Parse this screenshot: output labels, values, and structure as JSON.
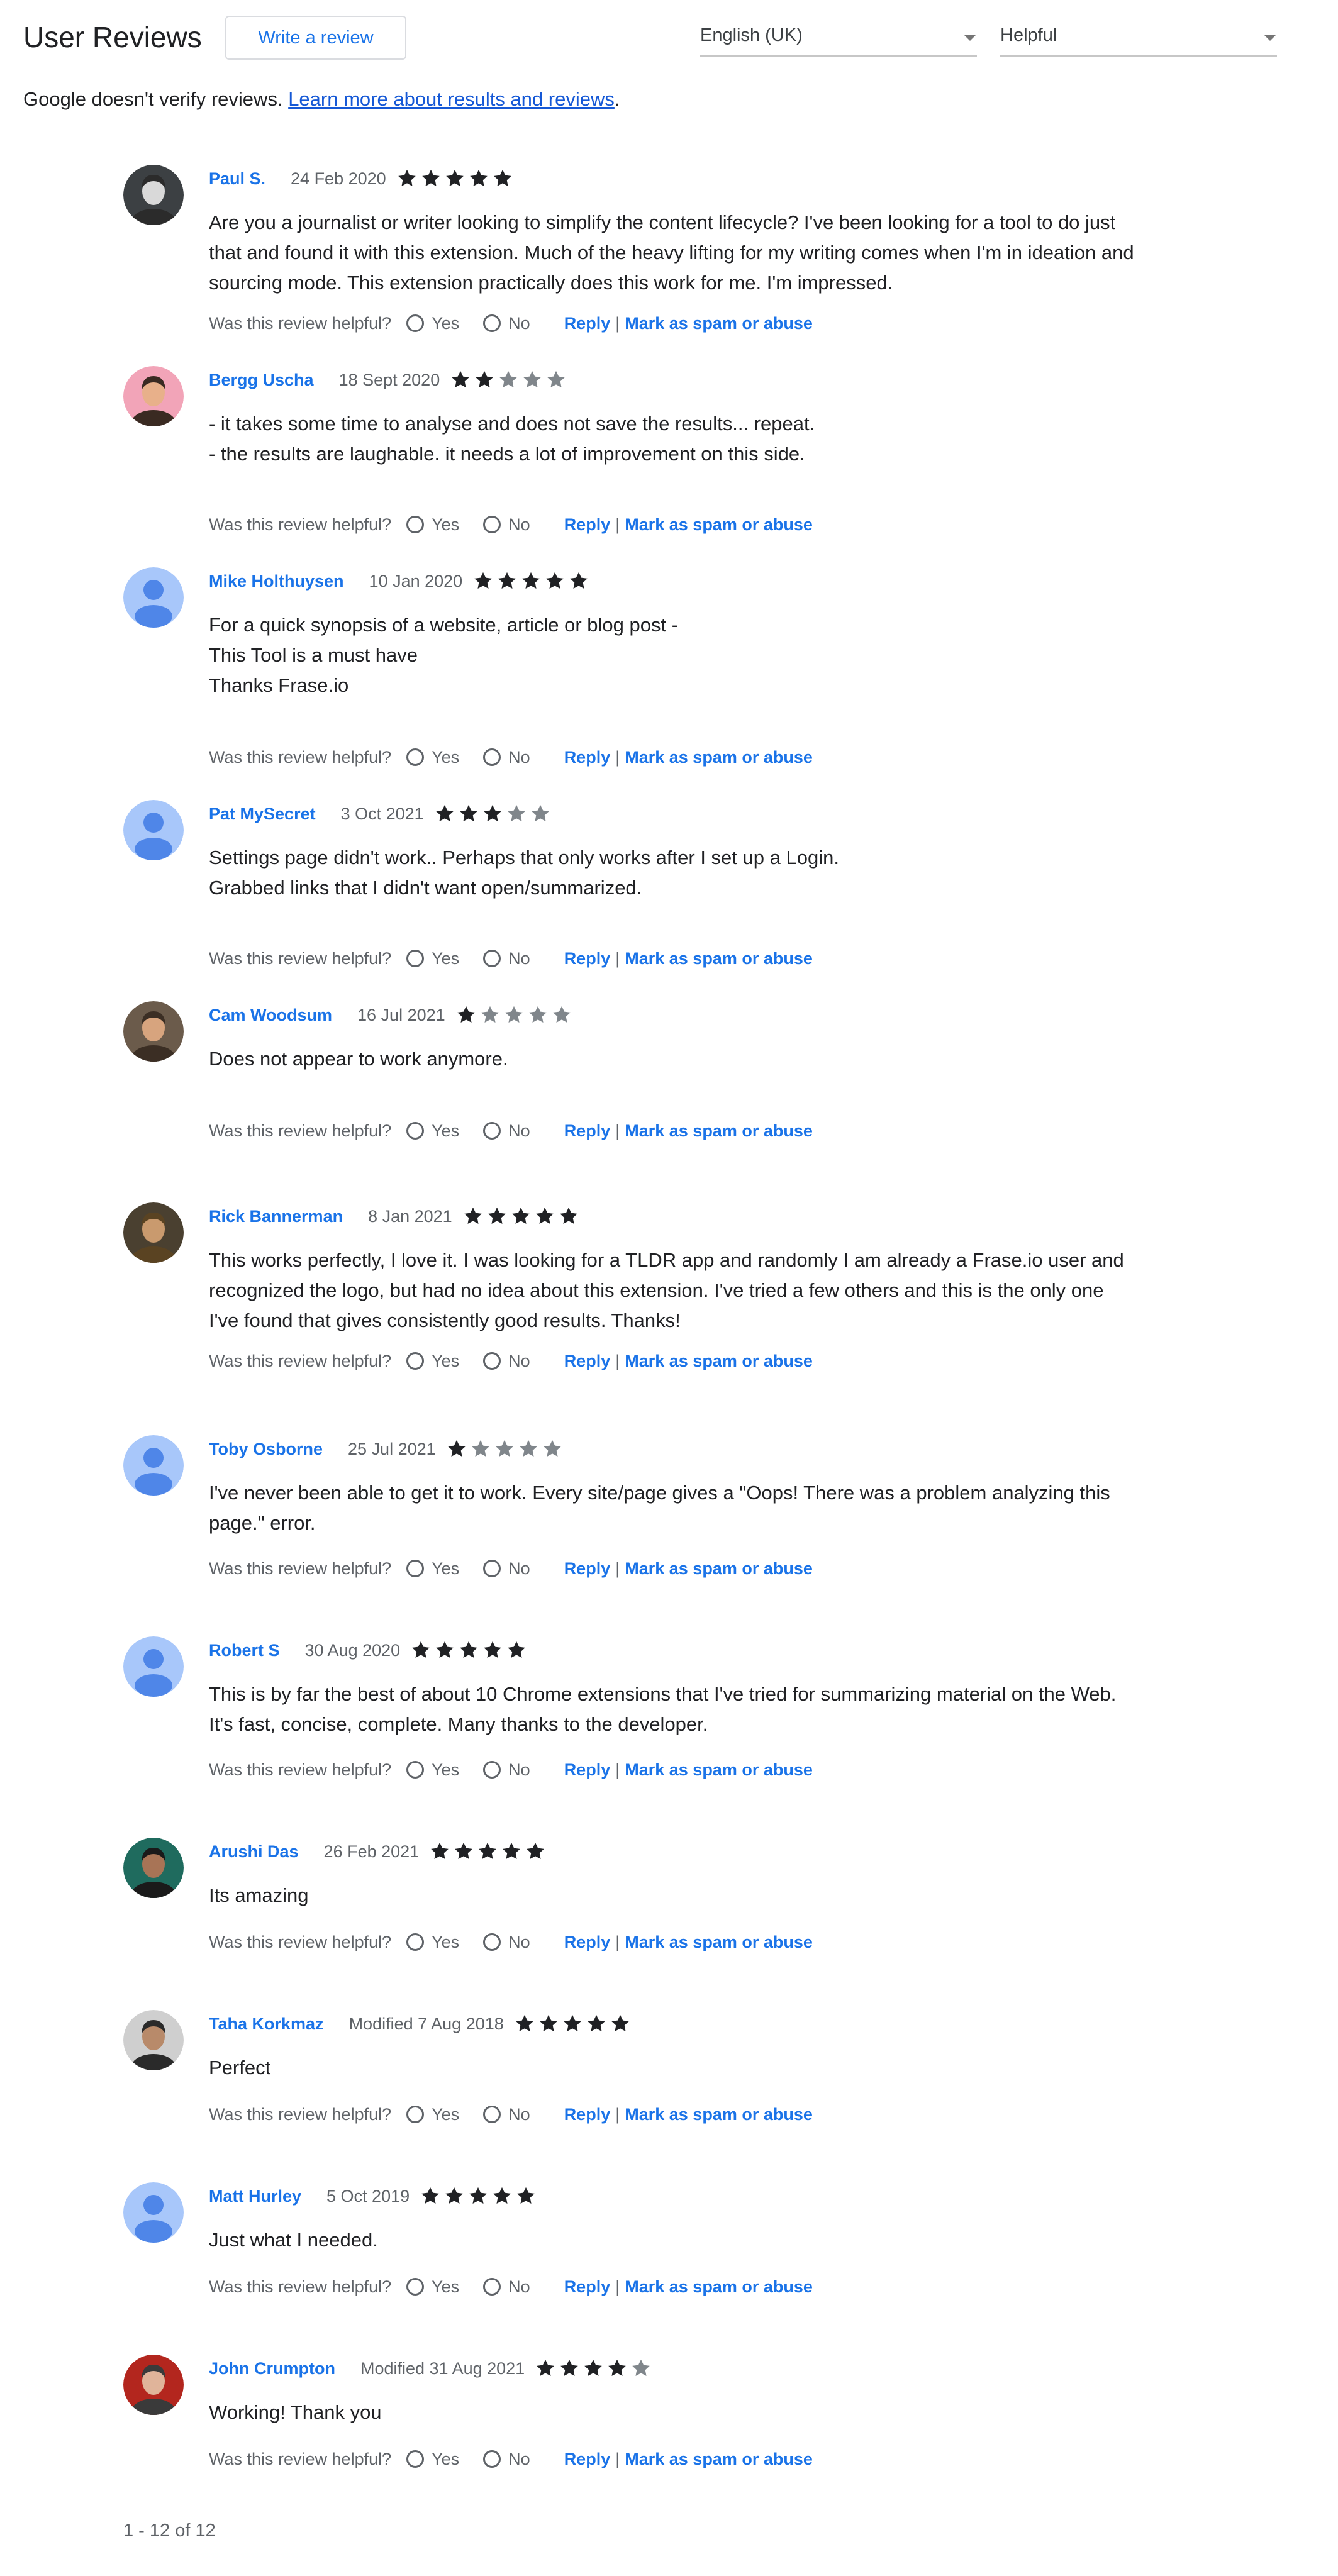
{
  "header": {
    "title": "User Reviews",
    "write_review_label": "Write a review",
    "language_select": "English (UK)",
    "sort_select": "Helpful"
  },
  "notice": {
    "text": "Google doesn't verify reviews.",
    "link_text": "Learn more about results and reviews",
    "suffix": "."
  },
  "helpful_labels": {
    "question": "Was this review helpful?",
    "yes": "Yes",
    "no": "No",
    "reply": "Reply",
    "separator": "|",
    "spam": "Mark as spam or abuse"
  },
  "colors": {
    "link": "#1a73e8",
    "star_filled": "#202124",
    "star_empty": "#80868b",
    "avatar_placeholder_bg": "#a8c7fa",
    "avatar_placeholder_fg": "#4f86e8"
  },
  "reviews": [
    {
      "author": "Paul S.",
      "date": "24 Feb 2020",
      "rating": 5,
      "avatar": "photo",
      "text": "Are you a journalist or writer looking to simplify the content lifecycle? I've been looking for a tool to do just\nthat and found it with this extension. Much of the heavy lifting for my writing comes when I'm in ideation and\nsourcing mode. This extension practically does this work for me. I'm impressed."
    },
    {
      "author": "Bergg Uscha",
      "date": "18 Sept 2020",
      "rating": 2,
      "avatar": "photo",
      "text": "- it takes some time to analyse and does not save the results... repeat.\n- the results are laughable. it needs a lot of improvement on this side."
    },
    {
      "author": "Mike Holthuysen",
      "date": "10 Jan 2020",
      "rating": 5,
      "avatar": "placeholder",
      "text": "For a quick synopsis of a website, article or blog post -\nThis Tool is a must have\nThanks Frase.io"
    },
    {
      "author": "Pat MySecret",
      "date": "3 Oct 2021",
      "rating": 3,
      "avatar": "placeholder",
      "text": "Settings page didn't work.. Perhaps that only works after I set up a Login.\nGrabbed links that I didn't want open/summarized."
    },
    {
      "author": "Cam Woodsum",
      "date": "16 Jul 2021",
      "rating": 1,
      "avatar": "photo",
      "text": "Does not appear to work anymore."
    },
    {
      "author": "Rick Bannerman",
      "date": "8 Jan 2021",
      "rating": 5,
      "avatar": "photo",
      "text": "This works perfectly, I love it. I was looking for a TLDR app and randomly I am already a Frase.io user and\nrecognized the logo, but had no idea about this extension. I've tried a few others and this is the only one\nI've found that gives consistently good results. Thanks!"
    },
    {
      "author": "Toby Osborne",
      "date": "25 Jul 2021",
      "rating": 1,
      "avatar": "placeholder",
      "text": "I've never been able to get it to work. Every site/page gives a \"Oops! There was a problem analyzing this\npage.\" error."
    },
    {
      "author": "Robert S",
      "date": "30 Aug 2020",
      "rating": 5,
      "avatar": "placeholder",
      "text": "This is by far the best of about 10 Chrome extensions that I've tried for summarizing material on the Web.\nIt's fast, concise, complete. Many thanks to the developer."
    },
    {
      "author": "Arushi Das",
      "date": "26 Feb 2021",
      "rating": 5,
      "avatar": "photo",
      "text": "Its amazing"
    },
    {
      "author": "Taha Korkmaz",
      "date": "Modified 7 Aug 2018",
      "rating": 5,
      "avatar": "photo",
      "text": "Perfect"
    },
    {
      "author": "Matt Hurley",
      "date": "5 Oct 2019",
      "rating": 5,
      "avatar": "placeholder",
      "text": "Just what I needed."
    },
    {
      "author": "John Crumpton",
      "date": "Modified 31 Aug 2021",
      "rating": 4,
      "avatar": "photo",
      "text": "Working! Thank you"
    }
  ],
  "pagination": "1 - 12 of 12"
}
